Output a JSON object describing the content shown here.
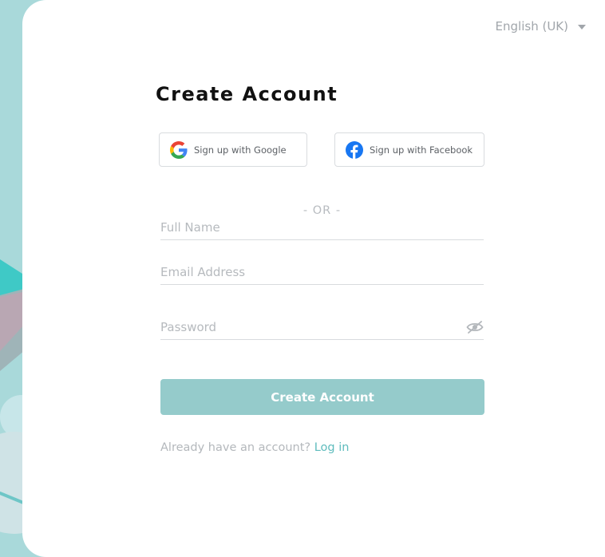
{
  "language": {
    "selected": "English (UK)"
  },
  "form": {
    "title": "Create Account",
    "google_label": "Sign up with Google",
    "facebook_label": "Sign up with Facebook",
    "or_divider": "- OR -",
    "fullname_placeholder": "Full Name",
    "email_placeholder": "Email Address",
    "password_placeholder": "Password",
    "submit_label": "Create Account",
    "login_prompt": "Already have an account?",
    "login_link": "Log in"
  },
  "icons": {
    "google": "google-g-logo",
    "facebook": "facebook-f-logo",
    "password_toggle": "eye-slash",
    "language_dropdown": "caret-down"
  },
  "colors": {
    "accent": "#95cbcb",
    "link": "#5fbcbd",
    "background": "#a9d9da",
    "facebook": "#1877f2"
  }
}
